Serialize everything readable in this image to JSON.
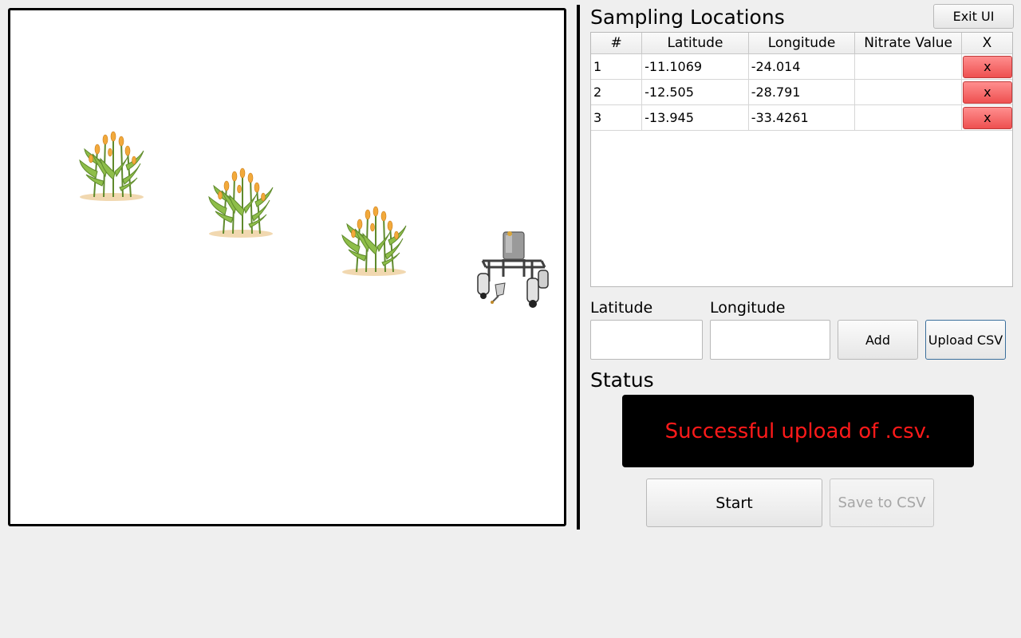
{
  "colors": {
    "status_text": "#ff1a1a",
    "status_background": "#000000",
    "delete_button": "#ee5050"
  },
  "header": {
    "title": "Sampling Locations",
    "exit_label": "Exit UI"
  },
  "table": {
    "columns": [
      "#",
      "Latitude",
      "Longitude",
      "Nitrate Value",
      "X"
    ],
    "rows": [
      {
        "index": "1",
        "latitude": "-11.1069",
        "longitude": "-24.014",
        "nitrate": "",
        "delete_label": "x"
      },
      {
        "index": "2",
        "latitude": "-12.505",
        "longitude": "-28.791",
        "nitrate": "",
        "delete_label": "x"
      },
      {
        "index": "3",
        "latitude": "-13.945",
        "longitude": "-33.4261",
        "nitrate": "",
        "delete_label": "x"
      }
    ]
  },
  "entry": {
    "latitude_label": "Latitude",
    "longitude_label": "Longitude",
    "latitude_value": "",
    "longitude_value": "",
    "add_label": "Add",
    "upload_label": "Upload CSV"
  },
  "status": {
    "heading": "Status",
    "message": "Successful upload of .csv."
  },
  "actions": {
    "start_label": "Start",
    "save_label": "Save to CSV"
  },
  "map": {
    "plant_icon": "corn-plant-icon",
    "robot_icon": "sampling-robot-icon"
  }
}
